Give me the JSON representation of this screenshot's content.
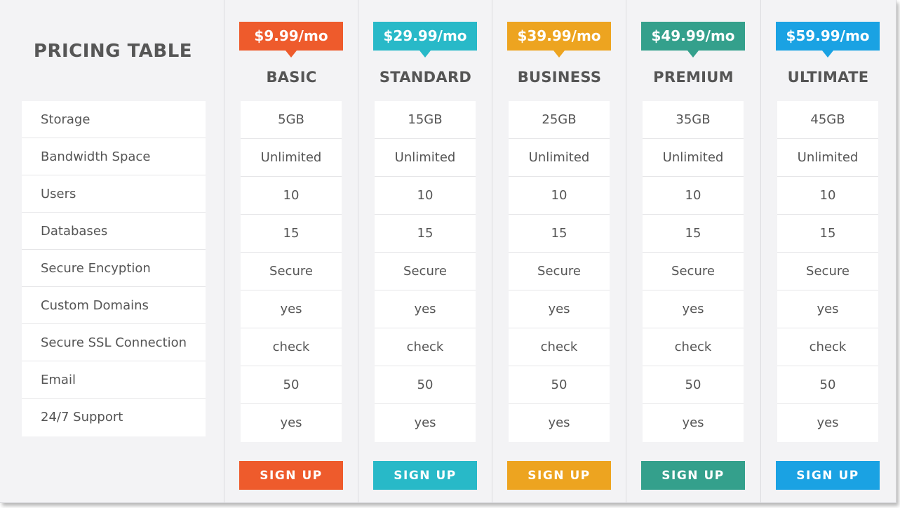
{
  "title": "PRICING TABLE",
  "features": [
    "Storage",
    "Bandwidth Space",
    "Users",
    "Databases",
    "Secure Encyption",
    "Custom Domains",
    "Secure SSL Connection",
    "Email",
    "24/7 Support"
  ],
  "plans": [
    {
      "price": "$9.99/mo",
      "name": "BASIC",
      "color": "#ee5b2c",
      "values": [
        "5GB",
        "Unlimited",
        "10",
        "15",
        "Secure",
        "yes",
        "check",
        "50",
        "yes"
      ],
      "cta": "SIGN UP"
    },
    {
      "price": "$29.99/mo",
      "name": "STANDARD",
      "color": "#28b9c8",
      "values": [
        "15GB",
        "Unlimited",
        "10",
        "15",
        "Secure",
        "yes",
        "check",
        "50",
        "yes"
      ],
      "cta": "SIGN UP"
    },
    {
      "price": "$39.99/mo",
      "name": "BUSINESS",
      "color": "#eda420",
      "values": [
        "25GB",
        "Unlimited",
        "10",
        "15",
        "Secure",
        "yes",
        "check",
        "50",
        "yes"
      ],
      "cta": "SIGN UP"
    },
    {
      "price": "$49.99/mo",
      "name": "PREMIUM",
      "color": "#34a08c",
      "values": [
        "35GB",
        "Unlimited",
        "10",
        "15",
        "Secure",
        "yes",
        "check",
        "50",
        "yes"
      ],
      "cta": "SIGN UP"
    },
    {
      "price": "$59.99/mo",
      "name": "ULTIMATE",
      "color": "#1aa2e3",
      "values": [
        "45GB",
        "Unlimited",
        "10",
        "15",
        "Secure",
        "yes",
        "check",
        "50",
        "yes"
      ],
      "cta": "SIGN UP"
    }
  ]
}
